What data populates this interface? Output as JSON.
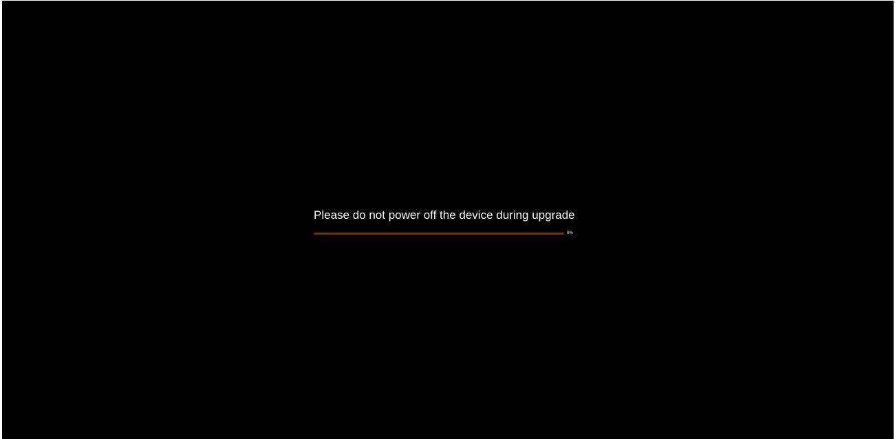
{
  "upgrade": {
    "message": "Please do not power off the device during upgrade",
    "progress_fraction": 0,
    "progress_label": "0%"
  },
  "colors": {
    "background": "#000000",
    "text": "#ffffff",
    "progress_track": "#6e3317",
    "progress_fill": "#e0702a"
  }
}
